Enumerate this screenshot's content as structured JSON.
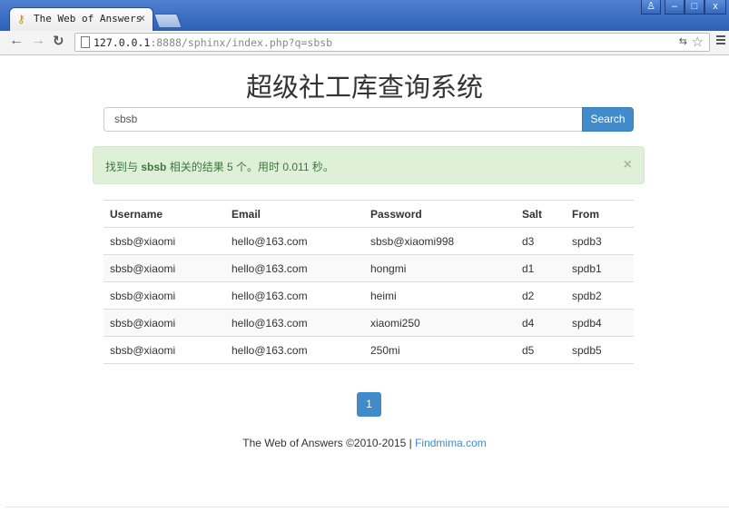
{
  "browser": {
    "tab_title": "The Web of Answers",
    "tab_close": "×",
    "url_host": "127.0.0.1",
    "url_rest": ":8888/sphinx/index.php?q=sbsb",
    "window_buttons": [
      "user",
      "minimize",
      "maximize",
      "close"
    ]
  },
  "page": {
    "title": "超级社工库查询系统",
    "search": {
      "value": "sbsb",
      "button_label": "Search"
    },
    "alert": {
      "prefix": "找到与 ",
      "keyword": "sbsb",
      "middle": " 相关的结果 5 个。用时 0.011 秒。",
      "close": "×",
      "color_bg": "#dff0d8",
      "color_text": "#3c763d"
    },
    "table": {
      "headers": [
        "Username",
        "Email",
        "Password",
        "Salt",
        "From"
      ],
      "rows": [
        [
          "sbsb@xiaomi",
          "hello@163.com",
          "sbsb@xiaomi998",
          "d3",
          "spdb3"
        ],
        [
          "sbsb@xiaomi",
          "hello@163.com",
          "hongmi",
          "d1",
          "spdb1"
        ],
        [
          "sbsb@xiaomi",
          "hello@163.com",
          "heimi",
          "d2",
          "spdb2"
        ],
        [
          "sbsb@xiaomi",
          "hello@163.com",
          "xiaomi250",
          "d4",
          "spdb4"
        ],
        [
          "sbsb@xiaomi",
          "hello@163.com",
          "250mi",
          "d5",
          "spdb5"
        ]
      ]
    },
    "pagination": {
      "current": "1"
    },
    "footer": {
      "text": "The Web of Answers ©2010-2015 | ",
      "link": "Findmima.com"
    },
    "accent_color": "#428bca"
  }
}
